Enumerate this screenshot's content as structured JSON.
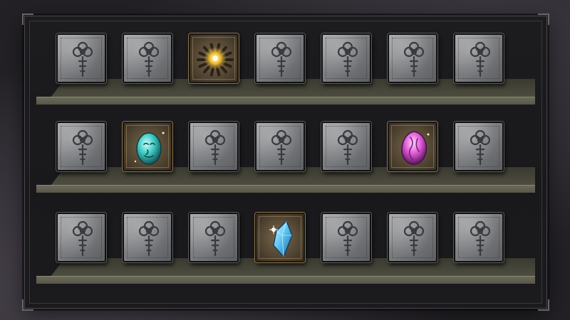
{
  "screen": "relic-shelf",
  "shelves": [
    {
      "slots": [
        {
          "state": "locked",
          "icon": "knot-emblem-icon"
        },
        {
          "state": "locked",
          "icon": "knot-emblem-icon"
        },
        {
          "state": "filled",
          "icon": "amber-shard-cluster-icon",
          "color": "#f2c23a"
        },
        {
          "state": "locked",
          "icon": "knot-emblem-icon"
        },
        {
          "state": "locked",
          "icon": "knot-emblem-icon"
        },
        {
          "state": "locked",
          "icon": "knot-emblem-icon"
        },
        {
          "state": "locked",
          "icon": "knot-emblem-icon"
        }
      ]
    },
    {
      "slots": [
        {
          "state": "locked",
          "icon": "knot-emblem-icon"
        },
        {
          "state": "filled",
          "icon": "teal-face-stone-icon",
          "color": "#3fc9c2"
        },
        {
          "state": "locked",
          "icon": "knot-emblem-icon"
        },
        {
          "state": "locked",
          "icon": "knot-emblem-icon"
        },
        {
          "state": "locked",
          "icon": "knot-emblem-icon"
        },
        {
          "state": "filled",
          "icon": "pink-crystal-stone-icon",
          "color": "#e05ad6"
        },
        {
          "state": "locked",
          "icon": "knot-emblem-icon"
        }
      ]
    },
    {
      "slots": [
        {
          "state": "locked",
          "icon": "knot-emblem-icon"
        },
        {
          "state": "locked",
          "icon": "knot-emblem-icon"
        },
        {
          "state": "locked",
          "icon": "knot-emblem-icon"
        },
        {
          "state": "filled",
          "icon": "blue-crystal-shard-icon",
          "color": "#5ec8f5"
        },
        {
          "state": "locked",
          "icon": "knot-emblem-icon"
        },
        {
          "state": "locked",
          "icon": "knot-emblem-icon"
        },
        {
          "state": "locked",
          "icon": "knot-emblem-icon"
        }
      ]
    }
  ]
}
